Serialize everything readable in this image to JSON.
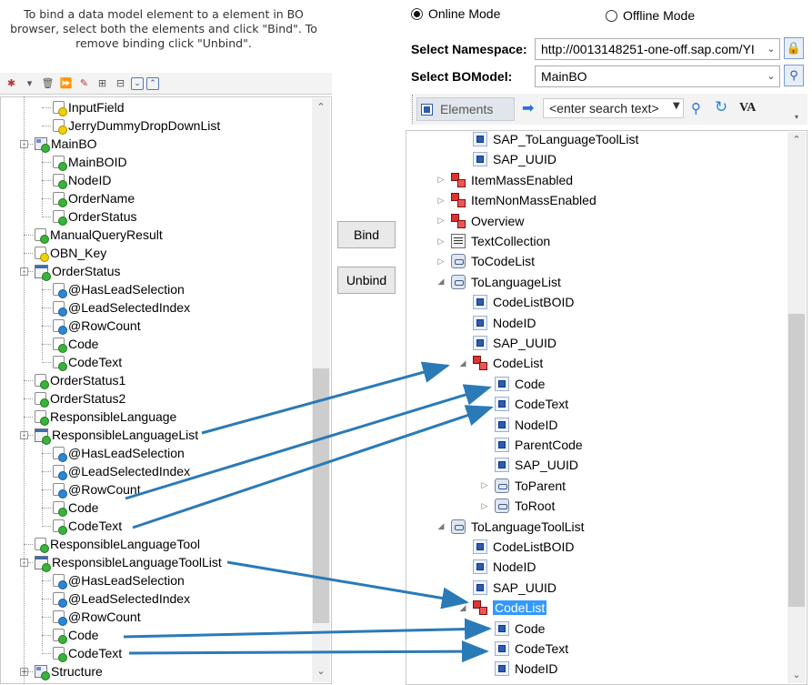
{
  "instructions": "To bind a data model element to a element in BO browser, select both the elements and click \"Bind\". To remove binding click \"Unbind\".",
  "left_tree": [
    {
      "label": "InputField",
      "icon": "field-yellow-icon"
    },
    {
      "label": "JerryDummyDropDownList",
      "icon": "field-yellow-icon"
    },
    {
      "label": "MainBO",
      "icon": "node-icon"
    },
    {
      "label": "MainBOID",
      "icon": "field-green-icon"
    },
    {
      "label": "NodeID",
      "icon": "field-green-icon"
    },
    {
      "label": "OrderName",
      "icon": "field-green-icon"
    },
    {
      "label": "OrderStatus",
      "icon": "field-green-icon"
    },
    {
      "label": "ManualQueryResult",
      "icon": "field-green-icon"
    },
    {
      "label": "OBN_Key",
      "icon": "field-yellow-icon"
    },
    {
      "label": "OrderStatus",
      "icon": "table-icon"
    },
    {
      "label": "@HasLeadSelection",
      "icon": "field-blue-icon"
    },
    {
      "label": "@LeadSelectedIndex",
      "icon": "field-blue-icon"
    },
    {
      "label": "@RowCount",
      "icon": "field-blue-icon"
    },
    {
      "label": "Code",
      "icon": "field-green-icon"
    },
    {
      "label": "CodeText",
      "icon": "field-green-icon"
    },
    {
      "label": "OrderStatus1",
      "icon": "field-green-icon"
    },
    {
      "label": "OrderStatus2",
      "icon": "field-green-icon"
    },
    {
      "label": "ResponsibleLanguage",
      "icon": "field-green-icon"
    },
    {
      "label": "ResponsibleLanguageList",
      "icon": "table-icon"
    },
    {
      "label": "@HasLeadSelection",
      "icon": "field-blue-icon"
    },
    {
      "label": "@LeadSelectedIndex",
      "icon": "field-blue-icon"
    },
    {
      "label": "@RowCount",
      "icon": "field-blue-icon"
    },
    {
      "label": "Code",
      "icon": "field-green-icon"
    },
    {
      "label": "CodeText",
      "icon": "field-green-icon"
    },
    {
      "label": "ResponsibleLanguageTool",
      "icon": "field-green-icon"
    },
    {
      "label": "ResponsibleLanguageToolList",
      "icon": "table-icon"
    },
    {
      "label": "@HasLeadSelection",
      "icon": "field-blue-icon"
    },
    {
      "label": "@LeadSelectedIndex",
      "icon": "field-blue-icon"
    },
    {
      "label": "@RowCount",
      "icon": "field-blue-icon"
    },
    {
      "label": "Code",
      "icon": "field-green-icon"
    },
    {
      "label": "CodeText",
      "icon": "field-green-icon"
    },
    {
      "label": "Structure",
      "icon": "node-icon"
    }
  ],
  "buttons": {
    "bind": "Bind",
    "unbind": "Unbind"
  },
  "modes": {
    "online": "Online Mode",
    "offline": "Offline Mode",
    "selected": "online"
  },
  "namespace": {
    "label": "Select Namespace:",
    "value": "http://0013148251-one-off.sap.com/YI"
  },
  "bomodel": {
    "label": "Select BOModel:",
    "value": "MainBO"
  },
  "toolbar": {
    "elements_label": "Elements",
    "search_placeholder": "<enter search text>",
    "va_label": "VA"
  },
  "right_tree": [
    {
      "label": "SAP_ToLanguageToolList",
      "icon": "element-icon",
      "tri": ""
    },
    {
      "label": "SAP_UUID",
      "icon": "element-icon",
      "tri": ""
    },
    {
      "label": "ItemMassEnabled",
      "icon": "structure-icon",
      "tri": "▷"
    },
    {
      "label": "ItemNonMassEnabled",
      "icon": "structure-icon",
      "tri": "▷"
    },
    {
      "label": "Overview",
      "icon": "structure-icon",
      "tri": "▷"
    },
    {
      "label": "TextCollection",
      "icon": "text-collection-icon",
      "tri": "▷"
    },
    {
      "label": "ToCodeList",
      "icon": "association-icon",
      "tri": "▷"
    },
    {
      "label": "ToLanguageList",
      "icon": "association-icon",
      "tri": "◢"
    },
    {
      "label": "CodeListBOID",
      "icon": "element-icon",
      "tri": ""
    },
    {
      "label": "NodeID",
      "icon": "element-icon",
      "tri": ""
    },
    {
      "label": "SAP_UUID",
      "icon": "element-icon",
      "tri": ""
    },
    {
      "label": "CodeList",
      "icon": "structure-icon",
      "tri": "◢"
    },
    {
      "label": "Code",
      "icon": "element-icon",
      "tri": ""
    },
    {
      "label": "CodeText",
      "icon": "element-icon",
      "tri": ""
    },
    {
      "label": "NodeID",
      "icon": "element-icon",
      "tri": ""
    },
    {
      "label": "ParentCode",
      "icon": "element-icon",
      "tri": ""
    },
    {
      "label": "SAP_UUID",
      "icon": "element-icon",
      "tri": ""
    },
    {
      "label": "ToParent",
      "icon": "association-icon",
      "tri": "▷"
    },
    {
      "label": "ToRoot",
      "icon": "association-icon",
      "tri": "▷"
    },
    {
      "label": "ToLanguageToolList",
      "icon": "association-icon",
      "tri": "◢"
    },
    {
      "label": "CodeListBOID",
      "icon": "element-icon",
      "tri": ""
    },
    {
      "label": "NodeID",
      "icon": "element-icon",
      "tri": ""
    },
    {
      "label": "SAP_UUID",
      "icon": "element-icon",
      "tri": ""
    },
    {
      "label": "CodeList",
      "icon": "structure-icon",
      "tri": "◢",
      "selected": true
    },
    {
      "label": "Code",
      "icon": "element-icon",
      "tri": ""
    },
    {
      "label": "CodeText",
      "icon": "element-icon",
      "tri": ""
    },
    {
      "label": "NodeID",
      "icon": "element-icon",
      "tri": ""
    }
  ],
  "colors": {
    "arrow": "#2a7ab8",
    "selection": "#3399ff"
  }
}
